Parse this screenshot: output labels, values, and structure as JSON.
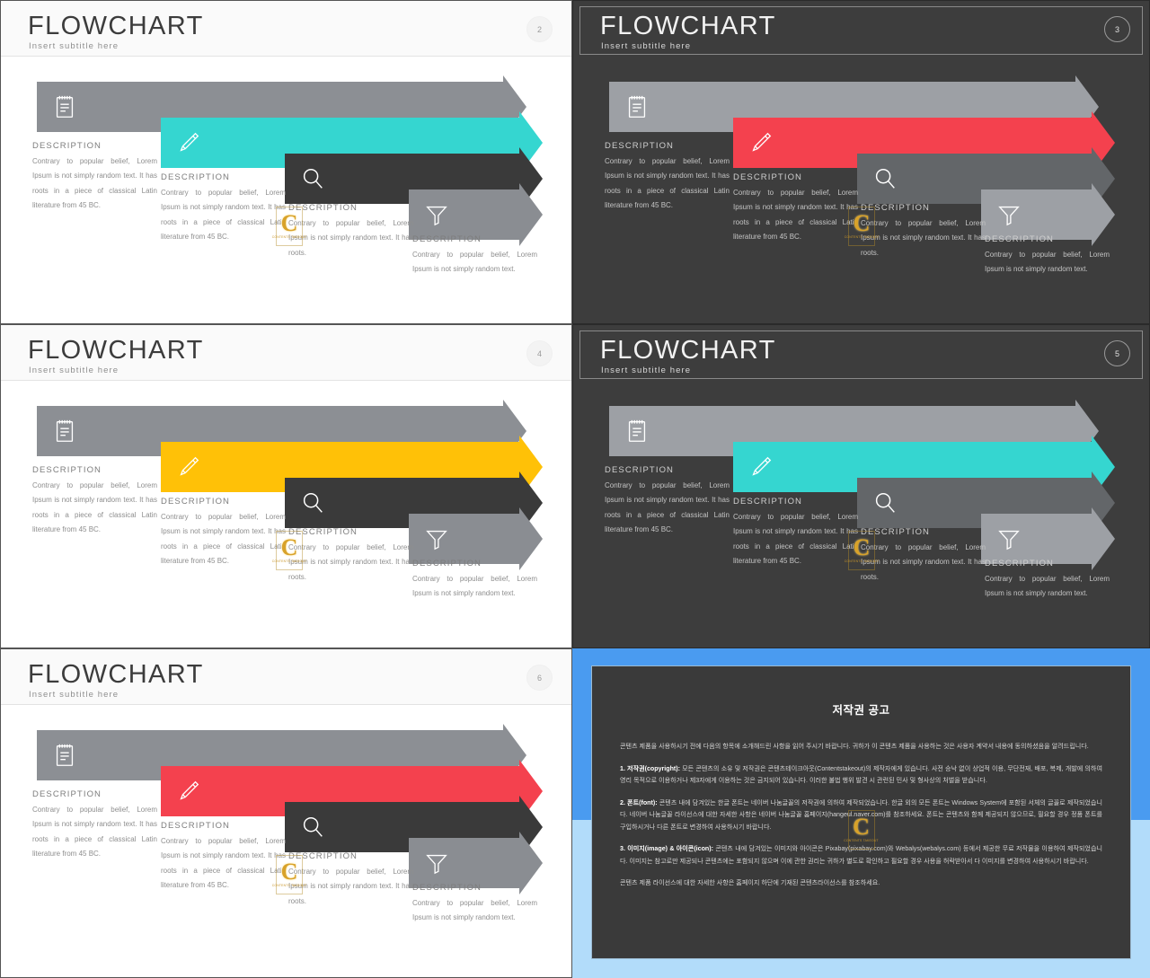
{
  "colors": {
    "teal": "#35d6d0",
    "red": "#f4414e",
    "amber": "#ffc107",
    "gray_light": "#8c8f94",
    "gray_mid": "#7c8086",
    "gray_dark": "#3a3a3a",
    "gray_dark_alt": "#8a8d92",
    "slide_dark_bg": "#3d3d3d",
    "slide_light_bg": "#ffffff",
    "blue_top": "#4a9bf0",
    "blue_bottom": "#b2dcfa"
  },
  "common": {
    "title": "FLOWCHART",
    "subtitle": "Insert subtitle here",
    "desc_label": "DESCRIPTION",
    "body_long": "Contrary to popular belief, Lorem Ipsum is not simply random text. It has roots in a piece of classical Latin literature from 45 BC.",
    "body_medium": "Contrary to popular belief, Lorem Ipsum is not simply random text. It has roots.",
    "body_short": "Contrary to popular belief, Lorem Ipsum is not simply random text.",
    "icons": [
      "notepad-icon",
      "pencil-icon",
      "magnifier-icon",
      "funnel-icon"
    ],
    "watermark_letter": "C",
    "watermark_text": "CONTENTS TAKEOUT"
  },
  "slides": [
    {
      "id": "slide-2",
      "page": "2",
      "theme": "light",
      "accent_index": 1,
      "accent": "#35d6d0"
    },
    {
      "id": "slide-3",
      "page": "3",
      "theme": "dark",
      "accent_index": 1,
      "accent": "#f4414e"
    },
    {
      "id": "slide-4",
      "page": "4",
      "theme": "light",
      "accent_index": 1,
      "accent": "#ffc107"
    },
    {
      "id": "slide-5",
      "page": "5",
      "theme": "dark",
      "accent_index": 1,
      "accent": "#35d6d0"
    },
    {
      "id": "slide-6",
      "page": "6",
      "theme": "light",
      "accent_index": 1,
      "accent": "#f4414e"
    }
  ],
  "copyright": {
    "title": "저작권 공고",
    "intro": "콘텐츠 제품을 사용하시기 전에 다음의 항목에 소개해드린 사항을 읽어 주시기 바랍니다. 귀하가 이 콘텐츠 제품을 사용하는 것은 사용자 계약서 내용에 동의하셨음을 알려드립니다.",
    "p1_label": "1. 저작권(copyright):",
    "p1": "모든 콘텐츠의 소유 및 저작권은 콘텐츠테이크아웃(Contentstakeout)의 제작자에게 있습니다. 사전 승낙 없이 상업적 이용, 무단전재, 배포, 복제, 개발에 의하여 영리 목적으로 이용하거나 제3자에게 이용하는 것은 금지되어 있습니다. 이러한 불법 행위 발견 시 관련된 민사 및 형사상의 처벌을 받습니다.",
    "p2_label": "2. 폰트(font):",
    "p2": "콘텐츠 내에 담겨있는 한글 폰트는 네이버 나눔글꼴의 저작권에 의하여 제작되었습니다. 한글 외의 모든 폰트는 Windows System에 포함된 서체의 글꼴로 제작되었습니다. 네이버 나눔글꼴 라이선스에 대한 자세한 사항은 네이버 나눔글꼴 홈페이지(hangeul.naver.com)를 참조하세요. 폰트는 콘텐츠와 함께 제공되지 않으므로, 필요할 경우 정품 폰트를 구입하시거나 다른 폰트로 변경하여 사용하시기 바랍니다.",
    "p3_label": "3. 이미지(image) & 아이콘(icon):",
    "p3": "콘텐츠 내에 담겨있는 이미지와 아이콘은 Pixabay(pixabay.com)와 Webalys(webalys.com) 등에서 제공한 무료 저작물을 이용하여 제작되었습니다. 이미지는 참고로만 제공되나 콘텐츠에는 포함되지 않으며 이에 관한 권리는 귀하가 별도로 확인하고 필요할 경우 사용을 허락받아서 다 이미지를 변경하여 사용하시기 바랍니다.",
    "outro": "콘텐츠 제품 라이선스에 대한 자세한 사항은 홈페이지 하단에 기재된 콘텐츠라이선스를 참조하세요."
  }
}
